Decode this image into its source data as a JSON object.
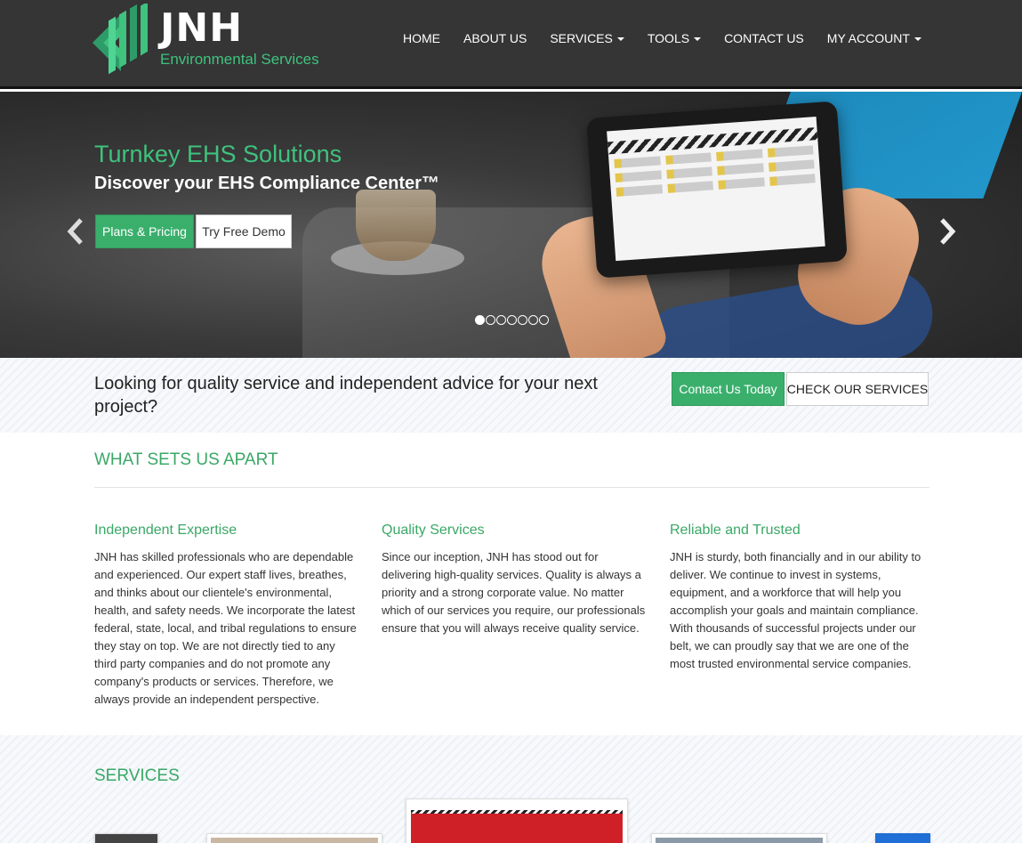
{
  "header": {
    "logo_name": "JNH",
    "logo_sub": "Environmental Services",
    "nav": [
      {
        "label": "HOME",
        "dropdown": false
      },
      {
        "label": "ABOUT US",
        "dropdown": false
      },
      {
        "label": "SERVICES",
        "dropdown": true
      },
      {
        "label": "TOOLS",
        "dropdown": true
      },
      {
        "label": "CONTACT US",
        "dropdown": false
      },
      {
        "label": "MY ACCOUNT",
        "dropdown": true
      }
    ]
  },
  "hero": {
    "title": "Turnkey EHS Solutions",
    "subtitle": "Discover your EHS Compliance Center™",
    "plans_label": "Plans & Pricing",
    "demo_label": "Try Free Demo",
    "slide_count": 7,
    "active_slide": 1
  },
  "cta": {
    "text": "Looking for quality service and independent advice for your next project?",
    "contact_label": "Contact Us Today",
    "services_label": "CHECK OUR SERVICES"
  },
  "apart": {
    "title": "WHAT SETS US APART",
    "columns": [
      {
        "heading": "Independent Expertise",
        "body": "JNH has skilled professionals who are dependable and experienced. Our expert staff lives, breathes, and thinks about our clientele's environmental, health, and safety needs. We incorporate the latest federal, state, local, and tribal regulations to ensure they stay on top. We are not directly tied to any third party companies and do not promote any company's products or services. Therefore, we always provide an independent perspective."
      },
      {
        "heading": "Quality Services",
        "body": "Since our inception, JNH has stood out for delivering high-quality services. Quality is always a priority and a strong corporate value. No matter which of our services you require, our professionals ensure that you will always receive quality service."
      },
      {
        "heading": "Reliable and Trusted",
        "body": "JNH is sturdy, both financially and in our ability to deliver. We continue to invest in systems, equipment, and a workforce that will help you accomplish your goals and maintain compliance. With thousands of successful projects under our belt, we can proudly say that we are one of the most trusted environmental service companies."
      }
    ]
  },
  "services": {
    "title": "SERVICES"
  },
  "colors": {
    "accent": "#3aa866",
    "header_bg": "#353535",
    "button_green": "#3aaf6c"
  }
}
